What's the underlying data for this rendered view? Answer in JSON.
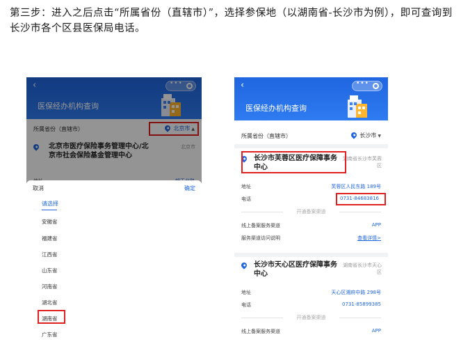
{
  "instruction": "第三步：进入之后点击“所属省份（直辖市）”，选择参保地（以湖南省-长沙市为例），即可查询到长沙市各个区县医保局电话。",
  "colors": {
    "brand_blue": "#1f66e0",
    "highlight_red": "#e02020"
  },
  "left_phone": {
    "back_icon": "‹",
    "capsule_dots": "•••",
    "title": "医保经办机构查询",
    "province_label": "所属省份（直辖市）",
    "province_value": "北京市",
    "card": {
      "name": "北京市医疗保险事务管理中心/北京市社会保险基金管理中心",
      "location": "北京市",
      "partial_left": "地址",
      "partial_right": "朝王北路"
    },
    "picker": {
      "cancel": "取消",
      "confirm": "确定",
      "placeholder": "请选择",
      "options": [
        "安徽省",
        "福建省",
        "江西省",
        "山东省",
        "河南省",
        "湖北省",
        "湖南省",
        "广东省"
      ],
      "selected": "湖南省"
    }
  },
  "right_phone": {
    "back_icon": "‹",
    "capsule_dots": "•••",
    "title": "医保经办机构查询",
    "province_label": "所属省份（直辖市）",
    "province_value": "长沙市",
    "cards": [
      {
        "name": "长沙市芙蓉区医疗保障事务中心",
        "location": "湖南省长沙市芙蓉区",
        "address_label": "地址",
        "address": "芙蓉区人民东路 189号",
        "phone_label": "电话",
        "phone": "0731-84683816",
        "channel_divider": "开通备案渠道",
        "online_label": "线上备案服务渠道",
        "online_value": "APP",
        "guide_label": "服务渠道访问说明",
        "guide_link": "查看详情>"
      },
      {
        "name": "长沙市天心区医疗保障事务中心",
        "location": "湖南省长沙市天心区",
        "address_label": "地址",
        "address": "天心区湘府中路 298号",
        "phone_label": "电话",
        "phone": "0731-85899385",
        "channel_divider": "开通备案渠道",
        "online_label": "线上备案服务渠道",
        "online_value": "APP"
      }
    ]
  }
}
